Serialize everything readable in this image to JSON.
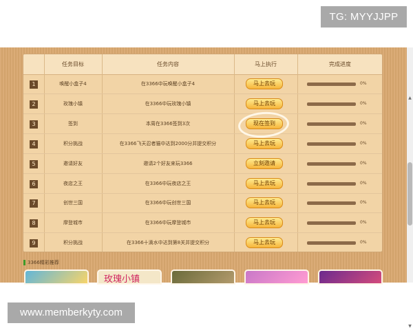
{
  "overlay": {
    "tg_label": "TG: MYYJJPP",
    "website": "www.memberkyty.com"
  },
  "table": {
    "headers": [
      "任务目标",
      "任务内容",
      "马上执行",
      "完成进度"
    ],
    "rows": [
      {
        "num": "1",
        "target": "唤醒小盒子4",
        "content": "在3366中玩唤醒小盒子4",
        "action": "马上去玩",
        "progress": "0%"
      },
      {
        "num": "2",
        "target": "玫瑰小镇",
        "content": "在3366中玩玫瑰小镇",
        "action": "马上去玩",
        "progress": "0%"
      },
      {
        "num": "3",
        "target": "签到",
        "content": "本周在3366签到3次",
        "action": "现在签到",
        "progress": "0%"
      },
      {
        "num": "4",
        "target": "积分挑战",
        "content": "在3366飞天忍者猫中达到2000分并提交积分",
        "action": "马上去玩",
        "progress": "0%"
      },
      {
        "num": "5",
        "target": "邀请好友",
        "content": "邀请2个好友来玩3366",
        "action": "立刻邀请",
        "progress": "0%"
      },
      {
        "num": "6",
        "target": "夜店之王",
        "content": "在3366中玩夜店之王",
        "action": "马上去玩",
        "progress": "0%"
      },
      {
        "num": "7",
        "target": "创世三国",
        "content": "在3366中玩创世三国",
        "action": "马上去玩",
        "progress": "0%"
      },
      {
        "num": "8",
        "target": "摩登城市",
        "content": "在3366中玩摩登城市",
        "action": "马上去玩",
        "progress": "0%"
      },
      {
        "num": "9",
        "target": "积分挑战",
        "content": "在3366十滴水中达到第8关并提交积分",
        "action": "马上去玩",
        "progress": "0%"
      }
    ]
  },
  "recommend": {
    "title": "3366精彩推荐",
    "thumb_text": "玫瑰小镇"
  },
  "colors": {
    "accent_button": "#f6b43a",
    "panel": "#d9a870",
    "highlight_circle": "#fff7e7"
  }
}
